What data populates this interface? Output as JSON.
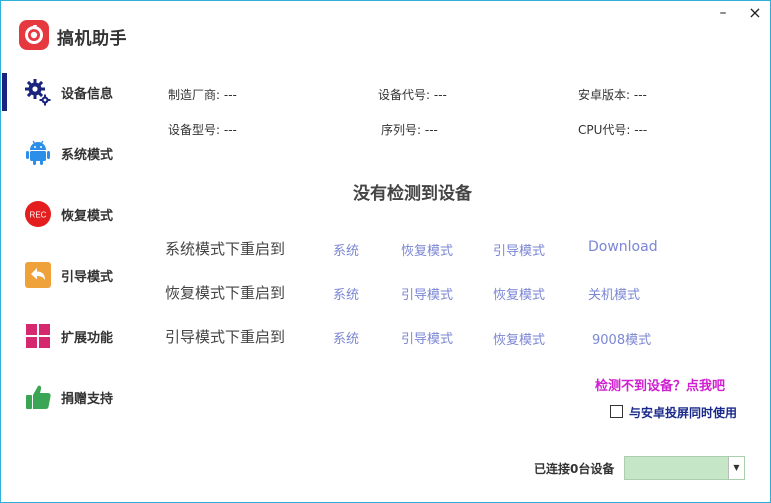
{
  "app": {
    "title": "搞机助手",
    "accent_color": "#e5393f",
    "minimize_glyph": "–",
    "close_glyph": "×"
  },
  "sidebar": {
    "active_index": 0,
    "items": [
      {
        "label": "设备信息",
        "icon": "gears-icon"
      },
      {
        "label": "系统模式",
        "icon": "android-icon"
      },
      {
        "label": "恢复模式",
        "icon": "rec-icon",
        "icon_text": "REC"
      },
      {
        "label": "引导模式",
        "icon": "back-arrow-icon"
      },
      {
        "label": "扩展功能",
        "icon": "grid-icon"
      },
      {
        "label": "捐赠支持",
        "icon": "thumbs-up-icon"
      }
    ]
  },
  "device_info": {
    "manufacturer": "制造厂商: ---",
    "device_code": "设备代号: ---",
    "android_version": "安卓版本: ---",
    "model": "设备型号: ---",
    "serial": "序列号: ---",
    "cpu_code": "CPU代号: ---"
  },
  "status": {
    "no_device": "没有检测到设备"
  },
  "reboot": {
    "rows": [
      {
        "label": "系统模式下重启到",
        "options": [
          "系统",
          "恢复模式",
          "引导模式",
          "Download"
        ]
      },
      {
        "label": "恢复模式下重启到",
        "options": [
          "系统",
          "引导模式",
          "恢复模式",
          "关机模式"
        ]
      },
      {
        "label": "引导模式下重启到",
        "options": [
          "系统",
          "引导模式",
          "恢复模式",
          "9008模式"
        ]
      }
    ]
  },
  "footer": {
    "detect_link": "检测不到设备？点我吧",
    "sync_label": "与安卓投屏同时使用",
    "sync_checked": false,
    "connected_label": "已连接0台设备",
    "device_select_value": ""
  },
  "colors": {
    "link": "#7b86d4",
    "detect_link": "#d01fd0",
    "active_marker": "#1a237e",
    "select_bg": "#c6e6c8",
    "border": "#2fb0d8"
  }
}
